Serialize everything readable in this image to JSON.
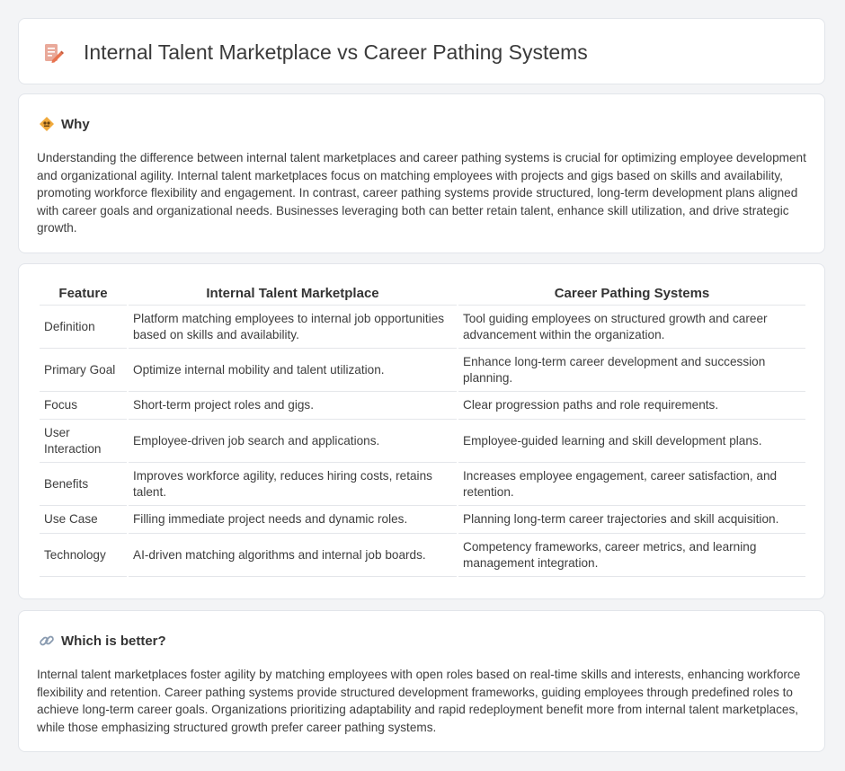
{
  "title": "Internal Talent Marketplace vs Career Pathing Systems",
  "why": {
    "heading": "Why",
    "body": "Understanding the difference between internal talent marketplaces and career pathing systems is crucial for optimizing employee development and organizational agility. Internal talent marketplaces focus on matching employees with projects and gigs based on skills and availability, promoting workforce flexibility and engagement. In contrast, career pathing systems provide structured, long-term development plans aligned with career goals and organizational needs. Businesses leveraging both can better retain talent, enhance skill utilization, and drive strategic growth."
  },
  "table": {
    "headers": [
      "Feature",
      "Internal Talent Marketplace",
      "Career Pathing Systems"
    ],
    "rows": [
      [
        "Definition",
        "Platform matching employees to internal job opportunities based on skills and availability.",
        "Tool guiding employees on structured growth and career advancement within the organization."
      ],
      [
        "Primary Goal",
        "Optimize internal mobility and talent utilization.",
        "Enhance long-term career development and succession planning."
      ],
      [
        "Focus",
        "Short-term project roles and gigs.",
        "Clear progression paths and role requirements."
      ],
      [
        "User Interaction",
        "Employee-driven job search and applications.",
        "Employee-guided learning and skill development plans."
      ],
      [
        "Benefits",
        "Improves workforce agility, reduces hiring costs, retains talent.",
        "Increases employee engagement, career satisfaction, and retention."
      ],
      [
        "Use Case",
        "Filling immediate project needs and dynamic roles.",
        "Planning long-term career trajectories and skill acquisition."
      ],
      [
        "Technology",
        "AI-driven matching algorithms and internal job boards.",
        "Competency frameworks, career metrics, and learning management integration."
      ]
    ]
  },
  "better": {
    "heading": "Which is better?",
    "body": "Internal talent marketplaces foster agility by matching employees with open roles based on real-time skills and interests, enhancing workforce flexibility and retention. Career pathing systems provide structured development frameworks, guiding employees through predefined roles to achieve long-term career goals. Organizations prioritizing adaptability and rapid redeployment benefit more from internal talent marketplaces, while those emphasizing structured growth prefer career pathing systems."
  },
  "icons": {
    "title": "document-pencil-icon",
    "why": "diamond-sign-icon",
    "better": "link-icon"
  }
}
